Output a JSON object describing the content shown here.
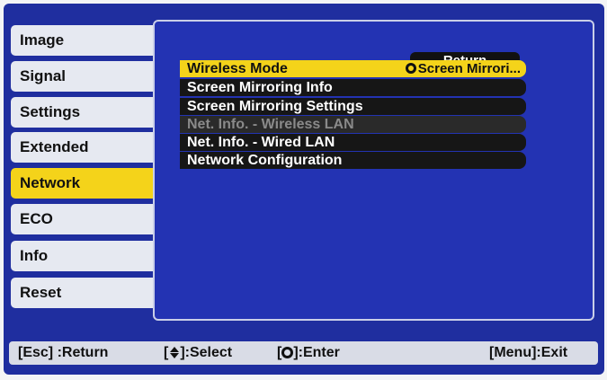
{
  "sidebar": {
    "items": [
      {
        "label": "Image"
      },
      {
        "label": "Signal"
      },
      {
        "label": "Settings"
      },
      {
        "label": "Extended"
      },
      {
        "label": "Network"
      },
      {
        "label": "ECO"
      },
      {
        "label": "Info"
      },
      {
        "label": "Reset"
      }
    ],
    "active": "Network"
  },
  "panel": {
    "return_label": "Return",
    "rows": [
      {
        "label": "Wireless Mode",
        "value": "Screen Mirrori...",
        "state": "selected"
      },
      {
        "label": "Screen Mirroring Info",
        "state": "normal"
      },
      {
        "label": "Screen Mirroring Settings",
        "state": "normal"
      },
      {
        "label": "Net. Info. - Wireless LAN",
        "state": "disabled"
      },
      {
        "label": "Net. Info. - Wired LAN",
        "state": "normal"
      },
      {
        "label": "Network Configuration",
        "state": "normal"
      }
    ]
  },
  "helpbar": {
    "esc": "[Esc] :Return",
    "select_prefix": "[",
    "select_suffix": "]:Select",
    "enter_prefix": "[",
    "enter_suffix": "]:Enter",
    "menu": "[Menu]:Exit"
  },
  "colors": {
    "background": "#1f2e9f",
    "highlight": "#f4d31a",
    "row": "#161616"
  },
  "icons": {
    "enter": "enter-icon",
    "updown": "up-down-icon"
  }
}
